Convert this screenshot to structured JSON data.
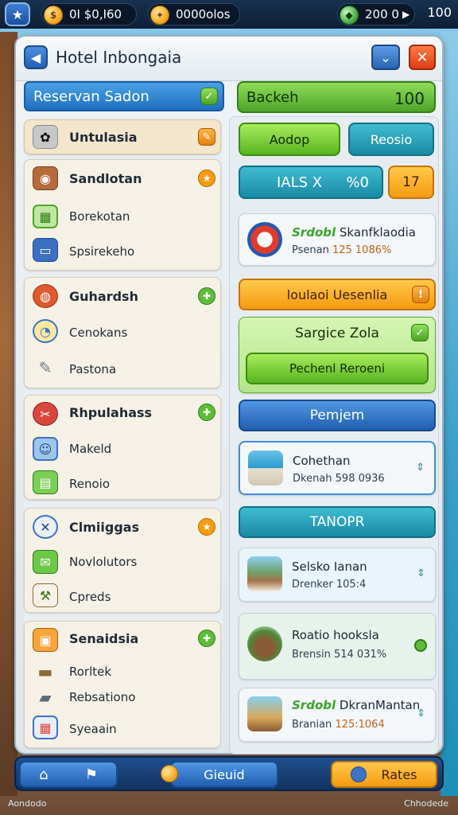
{
  "hud": {
    "coins": "0I $0,I60",
    "gold": "0000olos",
    "gems": "200 0",
    "level": "100"
  },
  "panel": {
    "title": "Hotel Inbongaia"
  },
  "left": {
    "reserv_label": "Reservan Sadon",
    "section_header": "Untulasia",
    "cards": [
      {
        "title": "Sandlotan",
        "rows": [
          "Borekotan",
          "Spsirekeho"
        ],
        "badge": "orange"
      },
      {
        "title": "Guhardsh",
        "rows": [
          "Cenokans",
          "Pastona"
        ],
        "badge": "green"
      },
      {
        "title": "Rhpulahass",
        "rows": [
          "Makeld",
          "Renoio"
        ],
        "badge": "green"
      },
      {
        "title": "Clmiiggas",
        "rows": [
          "Novlolutors",
          "Cpreds"
        ],
        "badge": "orange"
      },
      {
        "title": "Senaidsia",
        "rows": [
          "Rorltek",
          "Rebsationo",
          "Syeaain"
        ],
        "badge": "green"
      }
    ]
  },
  "right": {
    "backeh_label": "Backeh",
    "backeh_value": "100",
    "btn_aodop": "Aodop",
    "btn_reosio": "Reosio",
    "ials_label": "IALS X",
    "ials_value": "%0",
    "small_value": "17",
    "card1": {
      "name": "Skanfklaodia",
      "name_prefix": "Srdobl",
      "sub_label": "Psenan",
      "sub_num": "125 1086%"
    },
    "loulaoi_label": "loulaoi Uesenlia",
    "sargice_label": "Sargice Zola",
    "pechenl_label": "Pechenl Reroeni",
    "pemjem_label": "Pemjem",
    "card2": {
      "name": "Cohethan",
      "sub": "Dkenah 598 0936"
    },
    "tanopr_label": "TANOPR",
    "card3": {
      "name": "Selsko Ianan",
      "sub": "Drenker 105:4"
    },
    "card4": {
      "name": "Roatio hooksla",
      "sub": "Brensin 514 031%"
    },
    "card5": {
      "name": "DkranMantan",
      "name_prefix": "Srdobl",
      "sub_label": "Branian",
      "sub_num": "125:1064"
    }
  },
  "bottom": {
    "guest_label": "Gieuid",
    "rates_label": "Rates"
  },
  "footer": {
    "left": "Aondodo",
    "right": "Chhodede"
  },
  "colors": {
    "accent_blue": "#2160b5",
    "accent_green": "#4ba526",
    "accent_orange": "#f49b12",
    "accent_teal": "#1a8aa4",
    "close_red": "#dc3e14"
  }
}
